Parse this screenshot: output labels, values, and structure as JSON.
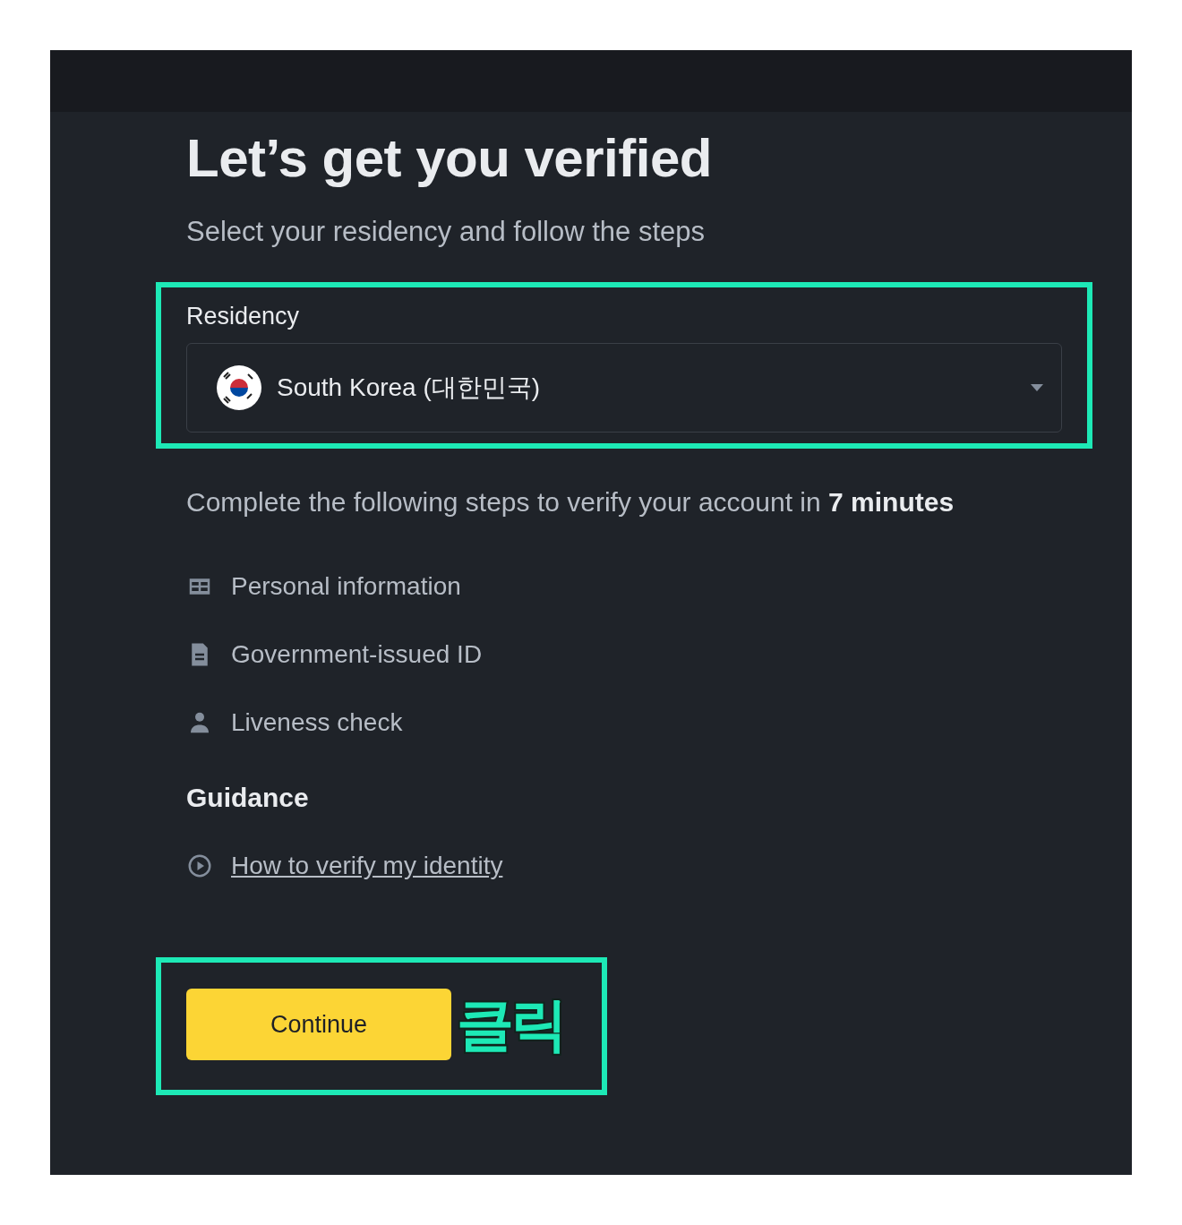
{
  "title": "Let’s get you verified",
  "subtitle": "Select your residency and follow the steps",
  "residency": {
    "label": "Residency",
    "value": "South Korea (대한민국)",
    "highlighted": true
  },
  "intro": "Complete the following steps to verify your account in **7 minutes**",
  "steps": [
    {
      "kind": "card",
      "label": "Personal information"
    },
    {
      "kind": "document",
      "label": "Government-issued ID"
    },
    {
      "kind": "person",
      "label": "Liveness check"
    }
  ],
  "guidance": {
    "heading": "Guidance",
    "link": "How to verify my identity"
  },
  "continue_button": {
    "label": "Continue",
    "highlighted": true,
    "annotation": "클릭"
  }
}
